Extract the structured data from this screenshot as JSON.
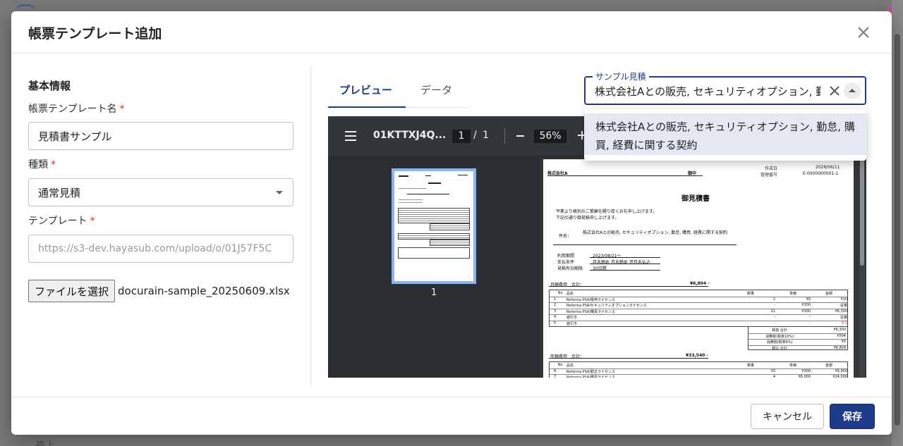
{
  "dialog": {
    "title": "帳票テンプレート追加",
    "close_icon": "close-icon"
  },
  "form": {
    "section_title": "基本情報",
    "name_label": "帳票テンプレート名",
    "name_value": "見積書サンプル",
    "type_label": "種類",
    "type_value": "通常見積",
    "template_label": "テンプレート",
    "template_url": "https://s3-dev.hayasub.com/upload/o/01J57F5C",
    "required_mark": "*",
    "file_button": "ファイルを選択",
    "file_name": "docurain-sample_20250609.xlsx"
  },
  "tabs": [
    {
      "label": "プレビュー",
      "active": true
    },
    {
      "label": "データ",
      "active": false
    }
  ],
  "sample_select": {
    "legend": "サンプル見積",
    "value": "株式会社Aとの販売, セキュリティオプション, 勤怠, 購買, 経費に関する契約",
    "options": [
      "株式会社Aとの販売, セキュリティオプション, 勤怠, 購買, 経費に関する契約"
    ]
  },
  "viewer": {
    "doc_name": "01KTTXJ4Q...",
    "page_current": "1",
    "page_sep": "/",
    "page_total": "1",
    "zoom": "56%",
    "thumb_label": "1",
    "bg_color": "#323639"
  },
  "preview_doc": {
    "customer": "株式会社A",
    "honorific": "御中",
    "issue_date_label": "作成日",
    "issue_date": "2026/06/11",
    "mgmt_no_label": "管理番号",
    "mgmt_no": "E-0000000001-1",
    "title": "御見積書",
    "greeting_1": "平素より格別のご愛顧を賜り厚くお礼申し上げます。",
    "greeting_2": "下記の通り御見積申し上げます。",
    "subject_label": "件名：",
    "subject": "株式会社Aとの販売, セキュリティオプション, 勤怠, 購買, 経費に関する契約",
    "period_label": "利用期間",
    "period": "2023/08/21〜",
    "payment_label": "支払条件",
    "payment": "月末締め 月末締め 翌月末払込",
    "validity_label": "見積有効期限",
    "validity": "30日間",
    "monthly_label": "月額費用　合計：",
    "monthly_total": "¥6,804 -",
    "annual_label": "年額費用　合計：",
    "annual_total": "¥33,540 -",
    "table_headers": [
      "No",
      "品名",
      "数量",
      "単価",
      "金額"
    ],
    "monthly_rows": [
      [
        "1",
        "Reforma PSA/販売ライセンス",
        "2",
        "¥0",
        "¥10"
      ],
      [
        "2",
        "Reforma PSA/セキュリティオプションライセンス",
        "-",
        "¥300",
        "従量"
      ],
      [
        "3",
        "Reforma PSA/購買ライセンス",
        "21",
        "¥300",
        "¥6,300"
      ],
      [
        "4",
        "値引き",
        "-",
        "-",
        "従量"
      ],
      [
        "5",
        "値引き",
        "-",
        "-",
        "¥-1"
      ]
    ],
    "summary_rows": [
      [
        "税抜 合計",
        "¥6,300"
      ],
      [
        "消費税(税率10%)",
        "¥504"
      ],
      [
        "消費税(税率8%)",
        "¥0"
      ],
      [
        "税込 合計",
        "¥6,804"
      ]
    ],
    "annual_rows": [
      [
        "6",
        "Reforma PSA/勤怠ライセンス",
        "33",
        "¥300",
        "¥9,900"
      ],
      [
        "7",
        "Reforma PSA/購買ライセンス",
        "4",
        "¥6,000",
        "¥24,000"
      ]
    ]
  },
  "footer": {
    "cancel": "キャンセル",
    "save": "保存"
  },
  "background": {
    "partial_text": "売上"
  },
  "colors": {
    "primary": "#1e3a8a",
    "required": "#d32f2f",
    "viewer_bg": "#323639",
    "thumb_highlight": "#8ab4f8"
  }
}
